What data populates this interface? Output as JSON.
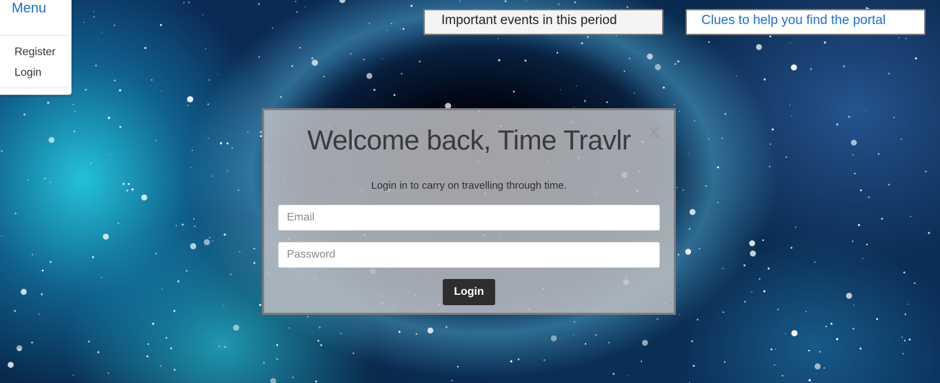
{
  "menu": {
    "title": "Menu",
    "items": [
      {
        "label": "Register"
      },
      {
        "label": "Login"
      }
    ]
  },
  "top_buttons": {
    "events": "Important events in this period",
    "clues": "Clues to help you find the portal"
  },
  "modal": {
    "title": "Welcome back, Time Travlr",
    "close": "X",
    "subtitle": "Login in to carry on travelling through time.",
    "email_placeholder": "Email",
    "password_placeholder": "Password",
    "login_button": "Login"
  },
  "colors": {
    "link_blue": "#1a6fd1",
    "button_dark": "#2e2e2e"
  }
}
